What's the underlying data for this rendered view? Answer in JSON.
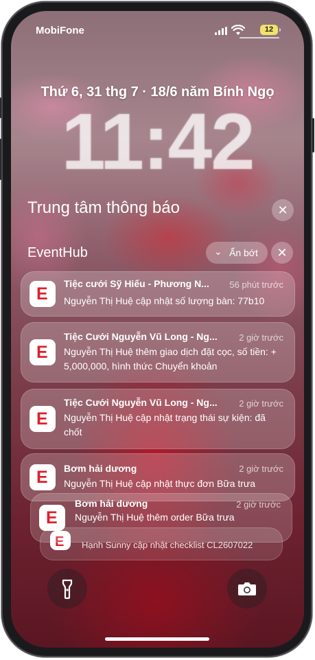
{
  "status": {
    "carrier": "MobiFone",
    "battery": "12"
  },
  "lock": {
    "date": "Thứ 6, 31 thg 7 · 18/6 năm Bính Ngọ",
    "time": "11:42"
  },
  "notification_center": {
    "title": "Trung tâm thông báo",
    "close": "✕"
  },
  "group": {
    "app_name": "EventHub",
    "collapse_label": "Ẩn bớt",
    "close": "✕",
    "icon_letter": "E"
  },
  "notifications": [
    {
      "title": "Tiệc cưới Sỹ Hiếu -  Phương N...",
      "time": "56 phút trước",
      "body": "Nguyễn Thị Huệ cập nhật số lượng bàn: 77b10"
    },
    {
      "title": "Tiệc Cưới Nguyễn Vũ Long - Ng...",
      "time": "2 giờ trước",
      "body": "Nguyễn Thị Huệ thêm giao dịch đặt cọc, số tiền: + 5,000,000, hình thức Chuyển khoản"
    },
    {
      "title": "Tiệc Cưới Nguyễn Vũ Long - Ng...",
      "time": "2 giờ trước",
      "body": "Nguyễn Thị Huệ cập nhật trạng thái sự kiện: đã chốt"
    },
    {
      "title": "Bơm hải dương",
      "time": "2 giờ trước",
      "body": "Nguyễn Thị Huệ cập nhật thực đơn Bữa trưa"
    },
    {
      "title": "Bơm hải dương",
      "time": "2 giờ trước",
      "body": "Nguyễn Thị Huệ thêm order Bữa trưa"
    },
    {
      "title": "",
      "time": "",
      "body": "Hạnh Sunny cập nhật checklist CL2607022"
    }
  ]
}
